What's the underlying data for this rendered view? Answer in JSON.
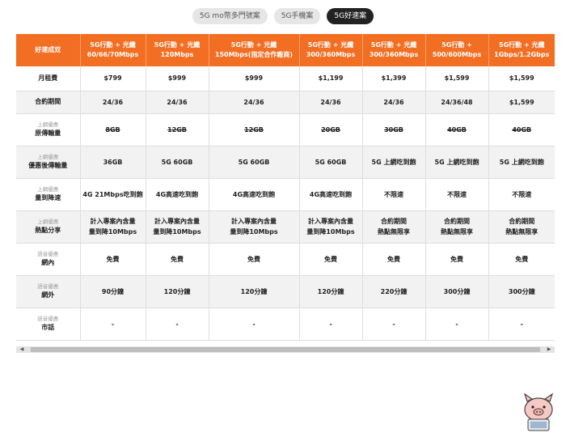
{
  "tabs": [
    {
      "label": "5G mo幣多門號案",
      "active": false
    },
    {
      "label": "5G手機案",
      "active": false
    },
    {
      "label": "5G好速案",
      "active": true
    }
  ],
  "table": {
    "corner": "好速成双",
    "columns": [
      {
        "line1": "5G行動 + 光纖",
        "line2": "60/66/70Mbps"
      },
      {
        "line1": "5G行動 + 光纖",
        "line2": "120Mbps"
      },
      {
        "line1": "5G行動 + 光纖",
        "line2": "150Mbps(指定合作廠商)"
      },
      {
        "line1": "5G行動 + 光纖",
        "line2": "300/360Mbps"
      },
      {
        "line1": "5G行動 + 光纖",
        "line2": "300/360Mbps"
      },
      {
        "line1": "5G行動 +",
        "line2": "500/600Mbps"
      },
      {
        "line1": "5G行動 + 光纖",
        "line2": "1Gbps/1.2Gbps"
      }
    ],
    "rows": [
      {
        "sub": "",
        "label": "月租費",
        "cells": [
          "$799",
          "$999",
          "$999",
          "$1,199",
          "$1,399",
          "$1,599",
          "$1,599"
        ],
        "lines2": [
          "",
          "",
          "",
          "",
          "",
          "",
          ""
        ]
      },
      {
        "sub": "",
        "label": "合約期間",
        "cells": [
          "24/36",
          "24/36",
          "24/36",
          "24/36",
          "24/36",
          "24/36/48",
          "$1,599"
        ],
        "lines2": [
          "",
          "",
          "",
          "",
          "",
          "",
          ""
        ]
      },
      {
        "sub": "上網優惠",
        "label": "原傳輸量",
        "cells": [
          "8GB",
          "12GB",
          "12GB",
          "20GB",
          "30GB",
          "40GB",
          "40GB"
        ],
        "lines2": [
          "",
          "",
          "",
          "",
          "",
          "",
          ""
        ]
      },
      {
        "sub": "上網優惠",
        "label": "優惠後傳輸量",
        "cells": [
          "36GB",
          "5G 60GB",
          "5G 60GB",
          "5G 60GB",
          "5G 上網吃到飽",
          "5G 上網吃到飽",
          "5G 上網吃到飽"
        ],
        "lines2": [
          "",
          "",
          "",
          "",
          "",
          "",
          ""
        ]
      },
      {
        "sub": "上網優惠",
        "label": "量到降速",
        "cells": [
          "4G 21Mbps吃到飽",
          "4G高速吃到飽",
          "4G高速吃到飽",
          "4G高速吃到飽",
          "不限速",
          "不限速",
          "不限速"
        ],
        "lines2": [
          "",
          "",
          "",
          "",
          "",
          "",
          ""
        ]
      },
      {
        "sub": "上網優惠",
        "label": "熱點分享",
        "cells": [
          "計入專案內含量",
          "計入專案內含量",
          "計入專案內含量",
          "計入專案內含量",
          "合約期間",
          "合約期間",
          "合約期間"
        ],
        "lines2": [
          "量到降10Mbps",
          "量到降10Mbps",
          "量到降10Mbps",
          "量到降10Mbps",
          "熱點無限享",
          "熱點無限享",
          "熱點無限享"
        ]
      },
      {
        "sub": "語音優惠",
        "label": "網內",
        "cells": [
          "免費",
          "免費",
          "免費",
          "免費",
          "免費",
          "免費",
          "免費"
        ],
        "lines2": [
          "",
          "",
          "",
          "",
          "",
          "",
          ""
        ]
      },
      {
        "sub": "語音優惠",
        "label": "網外",
        "cells": [
          "90分鐘",
          "120分鐘",
          "120分鐘",
          "120分鐘",
          "220分鐘",
          "300分鐘",
          "300分鐘"
        ],
        "lines2": [
          "",
          "",
          "",
          "",
          "",
          "",
          ""
        ]
      },
      {
        "sub": "語音優惠",
        "label": "市話",
        "cells": [
          "-",
          "-",
          "-",
          "-",
          "-",
          "-",
          "-"
        ],
        "lines2": [
          "",
          "",
          "",
          "",
          "",
          "",
          ""
        ]
      }
    ]
  },
  "scroll": {
    "left_arrow": "◀",
    "right_arrow": "▶"
  },
  "colors": {
    "accent": "#f26e22",
    "shade": "#f2f2f2",
    "tab_active": "#222222"
  },
  "icons": {
    "mascot": "pig-mascot-icon"
  }
}
